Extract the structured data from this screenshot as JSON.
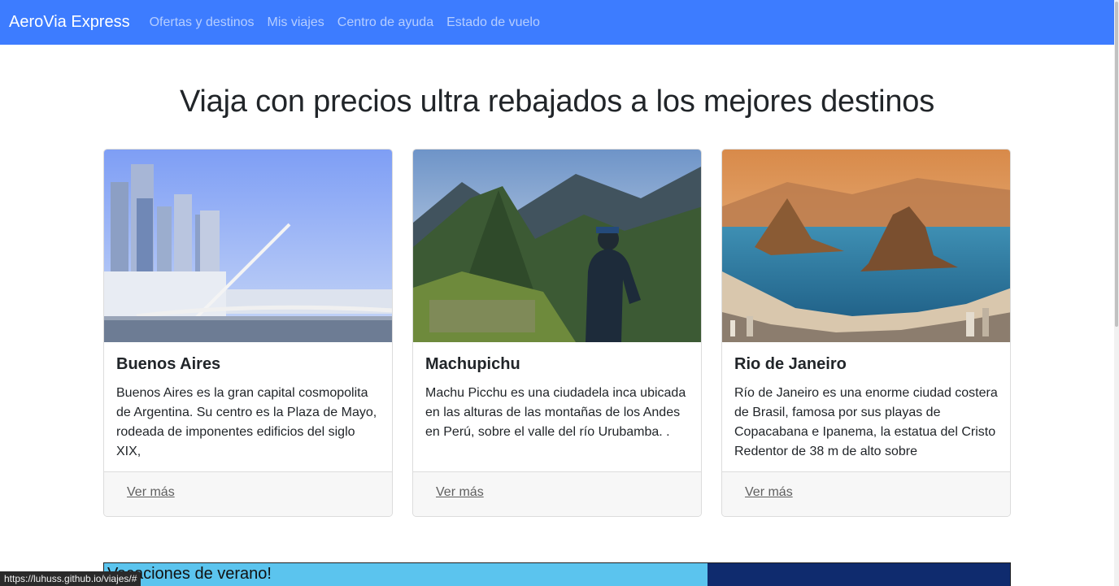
{
  "navbar": {
    "brand": "AeroVia Express",
    "links": [
      {
        "label": "Ofertas y destinos"
      },
      {
        "label": "Mis viajes"
      },
      {
        "label": "Centro de ayuda"
      },
      {
        "label": "Estado de vuelo"
      }
    ]
  },
  "hero": {
    "title": "Viaja con precios ultra rebajados a los mejores destinos"
  },
  "cards": [
    {
      "title": "Buenos Aires",
      "text": "Buenos Aires es la gran capital cosmopolita de Argentina. Su centro es la Plaza de Mayo, rodeada de imponentes edificios del siglo XIX,",
      "link": "Ver más"
    },
    {
      "title": "Machupichu",
      "text": "Machu Picchu es una ciudadela inca ubicada en las alturas de las montañas de los Andes en Perú, sobre el valle del río Urubamba. .",
      "link": "Ver más"
    },
    {
      "title": "Rio de Janeiro",
      "text": "Río de Janeiro es una enorme ciudad costera de Brasil, famosa por sus playas de Copacabana e Ipanema, la estatua del Cristo Redentor de 38 m de alto sobre",
      "link": "Ver más"
    }
  ],
  "summer": {
    "title": "Vacaciones de verano!"
  },
  "status_bar": {
    "url": "https://luhuss.github.io/viajes/#"
  },
  "colors": {
    "navbar": "#3d7cff",
    "summer_banner": "#5bc4ee"
  }
}
